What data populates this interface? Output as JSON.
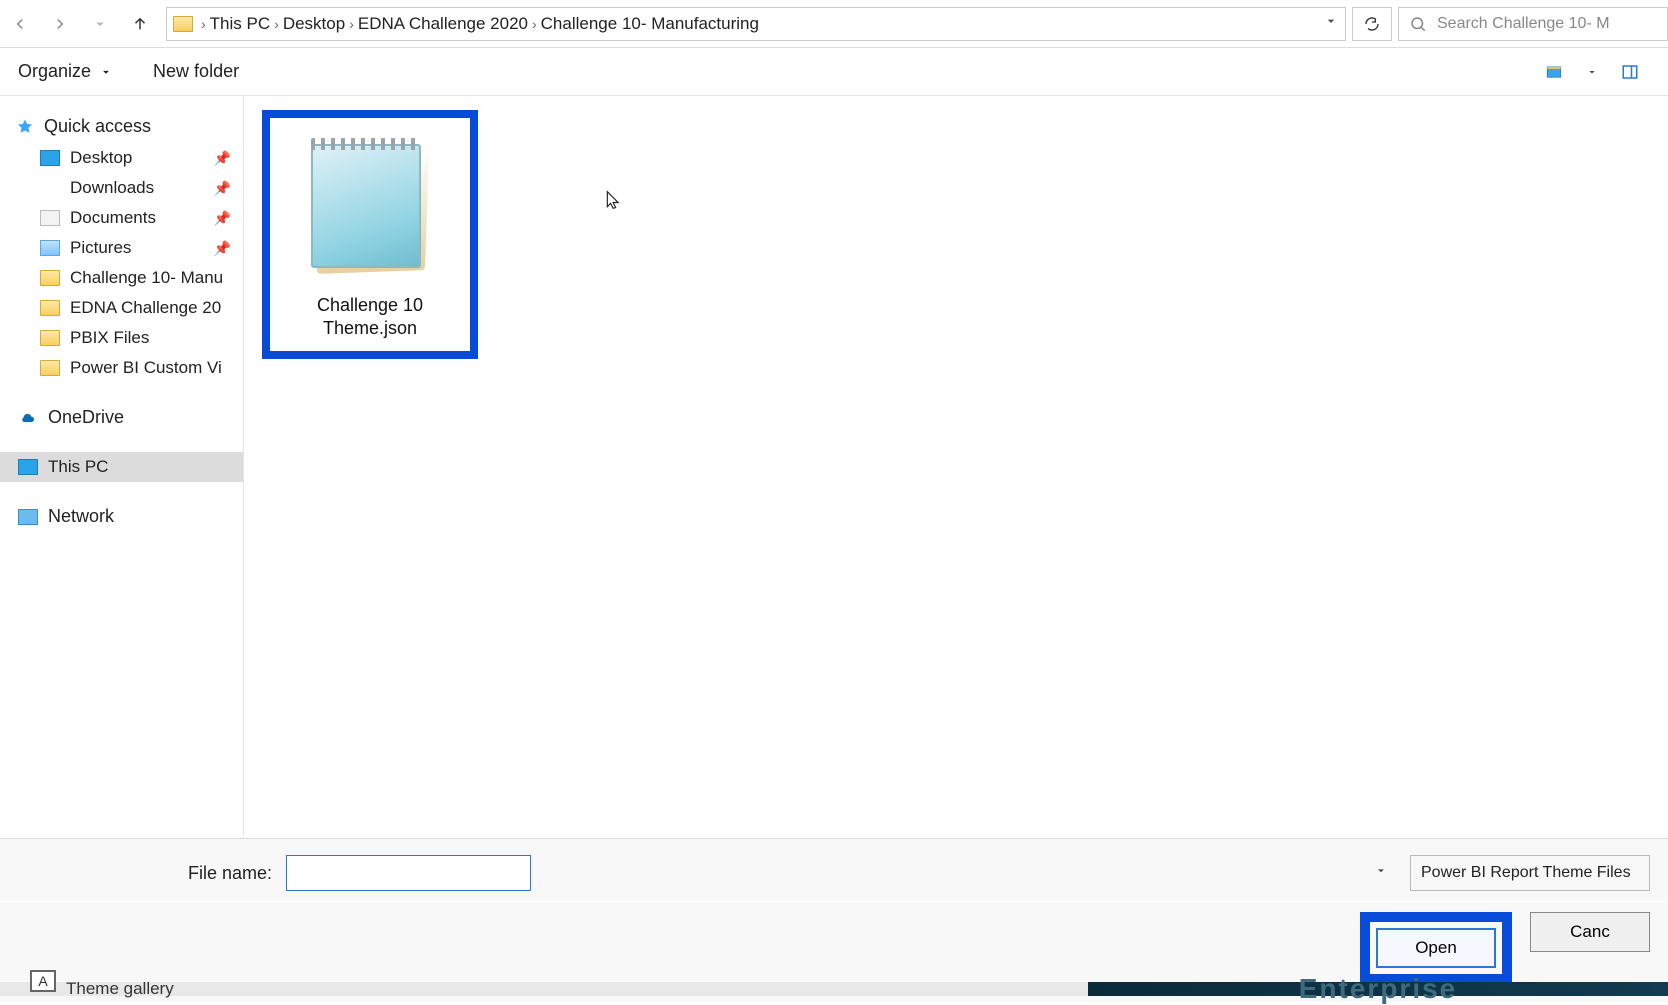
{
  "breadcrumbs": [
    "This PC",
    "Desktop",
    "EDNA Challenge 2020",
    "Challenge 10- Manufacturing"
  ],
  "search_placeholder": "Search Challenge 10- M",
  "toolbar": {
    "organize": "Organize",
    "new_folder": "New folder"
  },
  "sidebar": {
    "quick_access": "Quick access",
    "items": [
      {
        "label": "Desktop",
        "pinned": true
      },
      {
        "label": "Downloads",
        "pinned": true
      },
      {
        "label": "Documents",
        "pinned": true
      },
      {
        "label": "Pictures",
        "pinned": true
      },
      {
        "label": "Challenge 10- Manu",
        "pinned": false
      },
      {
        "label": "EDNA Challenge 20",
        "pinned": false
      },
      {
        "label": "PBIX Files",
        "pinned": false
      },
      {
        "label": "Power BI Custom Vi",
        "pinned": false
      }
    ],
    "onedrive": "OneDrive",
    "this_pc": "This PC",
    "network": "Network"
  },
  "file": {
    "name": "Challenge 10 Theme.json"
  },
  "bottom": {
    "file_name_label": "File name:",
    "file_name_value": "",
    "filter": "Power BI Report Theme Files"
  },
  "buttons": {
    "open": "Open",
    "cancel": "Canc"
  },
  "footer": {
    "left": "Theme gallery",
    "right": "Enterprise"
  }
}
